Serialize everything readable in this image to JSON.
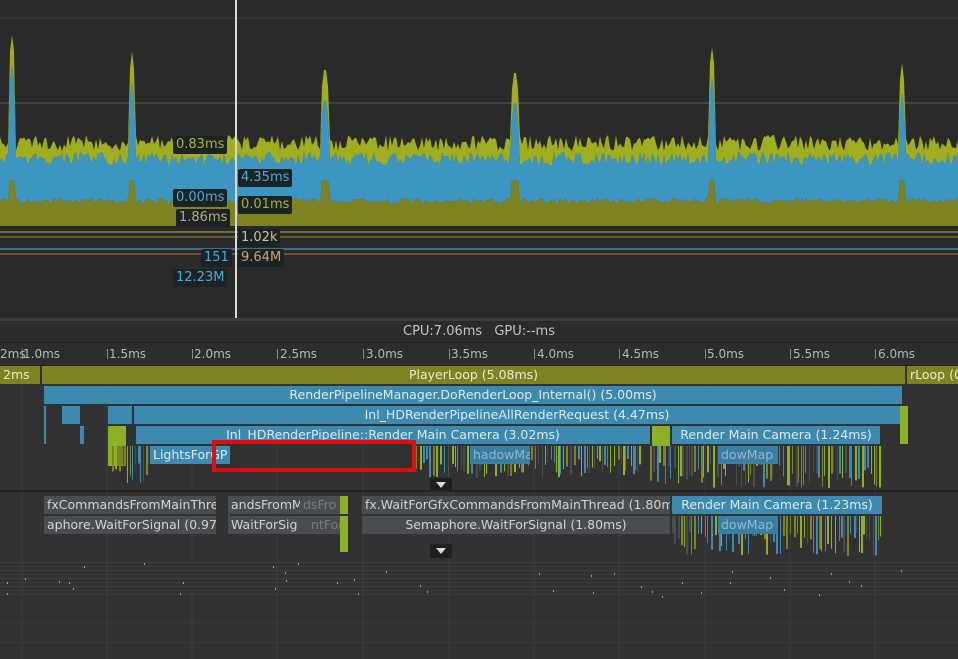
{
  "chart_overlay": {
    "cpu_values": [
      {
        "id": "v083",
        "text": "0.83ms",
        "color": "#a8b32a"
      },
      {
        "id": "v435",
        "text": "4.35ms",
        "color": "#4aaad6"
      },
      {
        "id": "v000",
        "text": "0.00ms",
        "color": "#4aaad6"
      },
      {
        "id": "v001",
        "text": "0.01ms",
        "color": "#a8b32a"
      },
      {
        "id": "v186",
        "text": "1.86ms",
        "color": "#b8b06a"
      }
    ],
    "other_values": [
      {
        "id": "v102k",
        "text": "1.02k",
        "color": "#d6c08a"
      },
      {
        "id": "v151",
        "text": "151",
        "color": "#4aaad6"
      },
      {
        "id": "v964",
        "text": "9.64M",
        "color": "#d6a060"
      },
      {
        "id": "v1223",
        "text": "12.23M",
        "color": "#4aaad6"
      }
    ]
  },
  "colors": {
    "olive": "#7f8220",
    "green": "#8cb026",
    "blue": "#3d8ab0",
    "gray": "#4a4d50",
    "selection": "#e30c0c"
  },
  "summary": {
    "cpu": "CPU:7.06ms",
    "gpu": "GPU:--ms"
  },
  "ruler": {
    "ticks": [
      "2ms",
      "1.0ms",
      "1.5ms",
      "2.0ms",
      "2.5ms",
      "3.0ms",
      "3.5ms",
      "4.0ms",
      "4.5ms",
      "5.0ms",
      "5.5ms",
      "6.0ms"
    ]
  },
  "main_thread": {
    "playerloop_left": "2ms",
    "playerloop": "PlayerLoop (5.08ms)",
    "playerloop_right": "rLoop (0",
    "render_loop": "RenderPipelineManager.DoRenderLoop_Internal() (5.00ms)",
    "all_request": "Inl_HDRenderPipelineAllRenderRequest (4.47ms)",
    "render_main_camera_1": "Inl_HDRenderPipeline::Render Main Camera (3.02ms)",
    "render_main_camera_2": "Render Main Camera (1.24ms)",
    "lights_for": "LightsForGP",
    "shadow_map": "hadowMa",
    "shadow_map_2": "dowMap"
  },
  "render_thread": {
    "wait_gfx_1": "fxCommandsFromMainThre",
    "wait_gfx_2": "andsFromM",
    "wait_gfx_2b": "dsFro",
    "wait_gfx_3": "fx.WaitForGfxCommandsFromMainThread (1.80m",
    "render_main_camera": "Render Main Camera (1.23ms)",
    "sem_1": "aphore.WaitForSignal (0.97",
    "sem_2": "WaitForSig",
    "sem_2b": "ntFor",
    "sem_3": "Semaphore.WaitForSignal (1.80ms)",
    "shadow_map": "dowMap"
  }
}
